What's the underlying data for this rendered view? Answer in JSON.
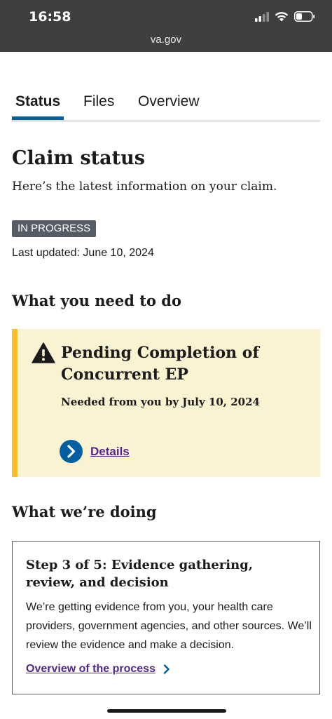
{
  "statusbar": {
    "time": "16:58",
    "url": "va.gov"
  },
  "tabs": [
    {
      "label": "Status",
      "active": true
    },
    {
      "label": "Files",
      "active": false
    },
    {
      "label": "Overview",
      "active": false
    }
  ],
  "claim_status": {
    "title": "Claim status",
    "intro": "Here’s the latest information on your claim.",
    "badge": "IN PROGRESS",
    "last_updated": "Last updated: June 10, 2024"
  },
  "need_to_do": {
    "heading": "What you need to do",
    "alert_title": "Pending Completion of Concurrent EP",
    "alert_due": "Needed from you by July 10, 2024",
    "details_link": "Details"
  },
  "doing": {
    "heading": "What we’re doing",
    "step_title": "Step 3 of 5: Evidence gathering, review, and decision",
    "step_body": "We’re getting evidence from you, your health care providers, government agencies, and other sources. We’ll review the evidence and make a decision.",
    "process_link": "Overview of the process"
  },
  "colors": {
    "tab_active": "#005ea2",
    "alert_bg": "#faf3d1",
    "alert_border": "#ffbe2e",
    "link": "#54278f",
    "badge_bg": "#565c65"
  }
}
